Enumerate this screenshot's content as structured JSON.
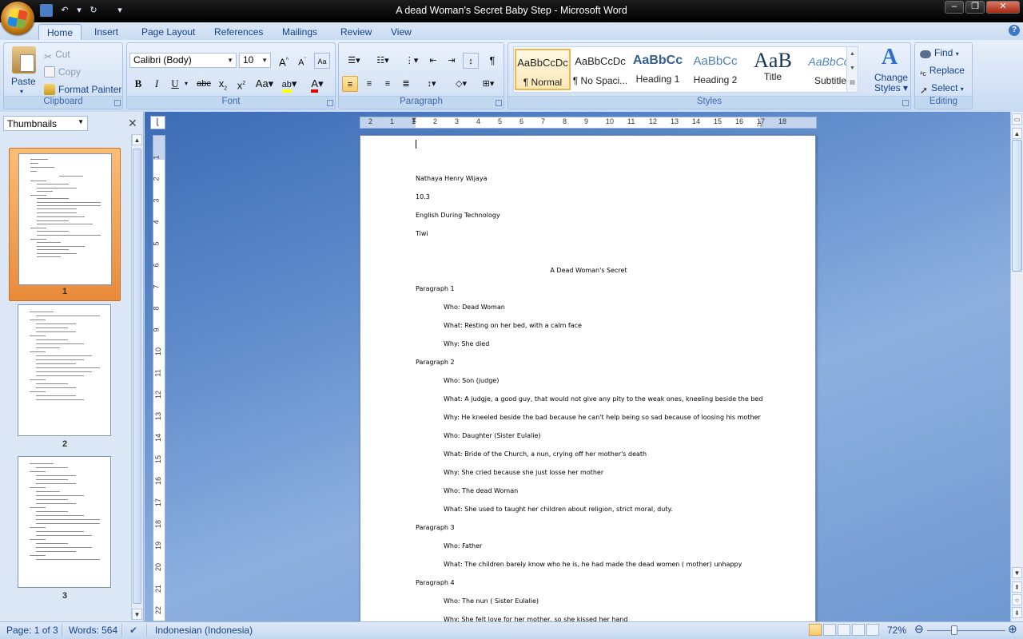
{
  "window": {
    "title": "A dead Woman's Secret Baby Step - Microsoft Word"
  },
  "tabs": [
    "Home",
    "Insert",
    "Page Layout",
    "References",
    "Mailings",
    "Review",
    "View"
  ],
  "ribbon": {
    "clipboard": {
      "label": "Clipboard",
      "paste": "Paste",
      "cut": "Cut",
      "copy": "Copy",
      "format_painter": "Format Painter"
    },
    "font": {
      "label": "Font",
      "name": "Calibri (Body)",
      "size": "10"
    },
    "paragraph": {
      "label": "Paragraph"
    },
    "styles": {
      "label": "Styles",
      "change_styles": "Change",
      "change_styles2": "Styles",
      "items": [
        {
          "preview": "AaBbCcDc",
          "name": "¶ Normal"
        },
        {
          "preview": "AaBbCcDc",
          "name": "¶ No Spaci..."
        },
        {
          "preview": "AaBbCc",
          "name": "Heading 1"
        },
        {
          "preview": "AaBbCc",
          "name": "Heading 2"
        },
        {
          "preview": "AaB",
          "name": "Title"
        },
        {
          "preview": "AaBbCc.",
          "name": "Subtitle"
        }
      ]
    },
    "editing": {
      "label": "Editing",
      "find": "Find",
      "replace": "Replace",
      "select": "Select"
    }
  },
  "nav_pane": {
    "view": "Thumbnails",
    "pages": [
      "1",
      "2",
      "3"
    ]
  },
  "ruler": {
    "h": [
      "2",
      "1",
      "1",
      "2",
      "3",
      "4",
      "5",
      "6",
      "7",
      "8",
      "9",
      "10",
      "11",
      "12",
      "13",
      "14",
      "15",
      "16",
      "17",
      "18"
    ],
    "v": [
      "1",
      "2",
      "3",
      "4",
      "5",
      "6",
      "7",
      "8",
      "9",
      "10",
      "11",
      "12",
      "13",
      "14",
      "15",
      "16",
      "17",
      "18",
      "19",
      "20",
      "21",
      "22"
    ]
  },
  "document": {
    "header_lines": [
      "Nathaya Henry Wijaya",
      "10.3",
      "English During Technology",
      "Tiwi"
    ],
    "title": "A Dead Woman's Secret",
    "lines": [
      {
        "text": "Paragraph 1",
        "indent": 0
      },
      {
        "text": "Who: Dead Woman",
        "indent": 1
      },
      {
        "text": "What:  Resting on her bed, with a calm face",
        "indent": 1
      },
      {
        "text": "Why: She died",
        "indent": 1
      },
      {
        "text": "Paragraph 2",
        "indent": 0
      },
      {
        "text": "Who: Son (judge)",
        "indent": 1
      },
      {
        "text": "What:  A judgje, a good guy, that would not give any pity to the weak ones, kneeling beside the bed",
        "indent": 1
      },
      {
        "text": "Why: He kneeled beside the bad because he can't help being so sad because of loosing his mother",
        "indent": 1
      },
      {
        "text": "Who: Daughter (Sister Eulalie)",
        "indent": 1
      },
      {
        "text": "What: Bride of the Church, a nun, crying off her mother's death",
        "indent": 1
      },
      {
        "text": "Why:  She cried because she just losse her mother",
        "indent": 1
      },
      {
        "text": "Who: The dead Woman",
        "indent": 1
      },
      {
        "text": "What: She used to taught her children about religion, strict moral, duty.",
        "indent": 1
      },
      {
        "text": "Paragraph 3",
        "indent": 0
      },
      {
        "text": "Who: Father",
        "indent": 1
      },
      {
        "text": "What: The children barely know who he is, he had made the dead women ( mother) unhappy",
        "indent": 1
      },
      {
        "text": "Paragraph 4",
        "indent": 0
      },
      {
        "text": "Who: The nun ( Sister Eulalie)",
        "indent": 1
      },
      {
        "text": "Why: She felt love for her mother, so she kissed her hand",
        "indent": 1
      }
    ]
  },
  "status": {
    "page": "Page: 1 of 3",
    "words": "Words: 564",
    "language": "Indonesian (Indonesia)",
    "zoom": "72%"
  },
  "colors": {
    "titlebar": "#000000",
    "ribbon": "#dbe7f6",
    "doc_bg": "#5f8bcb",
    "selected_thumb": "#f0a050"
  }
}
